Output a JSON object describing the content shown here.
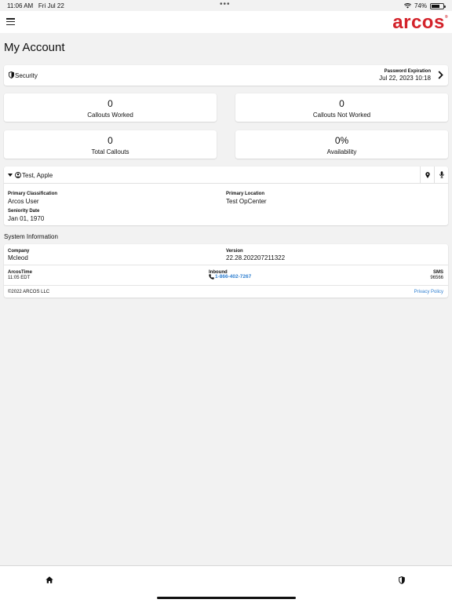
{
  "status": {
    "time": "11:06 AM",
    "date": "Fri Jul 22",
    "battery": "74%",
    "battery_level": 0.74
  },
  "brand": {
    "logo": "arcos",
    "trademark": "®",
    "color": "#d3222a"
  },
  "page": {
    "title": "My Account"
  },
  "security": {
    "label": "Security",
    "pw_title": "Password Expiration",
    "pw_date": "Jul 22, 2023 10:18"
  },
  "stats": [
    {
      "value": "0",
      "label": "Callouts Worked"
    },
    {
      "value": "0",
      "label": "Callouts Not Worked"
    },
    {
      "value": "0",
      "label": "Total Callouts"
    },
    {
      "value": "0%",
      "label": "Availability"
    }
  ],
  "profile": {
    "name": "Test, Apple",
    "primary_classification_title": "Primary Classification",
    "primary_classification": "Arcos User",
    "primary_location_title": "Primary Location",
    "primary_location": "Test OpCenter",
    "seniority_title": "Seniority Date",
    "seniority": "Jan 01, 1970"
  },
  "system": {
    "title": "System Information",
    "company_title": "Company",
    "company": "Mcleod",
    "version_title": "Version",
    "version": "22.28.202207211322",
    "arcostime_title": "ArcosTime",
    "arcostime": "11:05 EDT",
    "inbound_title": "Inbound",
    "inbound": "1-866-402-7267",
    "sms_title": "SMS",
    "sms": "96566",
    "copyright": "©2022 ARCOS LLC",
    "privacy": "Privacy Policy"
  },
  "colors": {
    "link": "#2f7fd0",
    "background": "#f2f2f2"
  }
}
